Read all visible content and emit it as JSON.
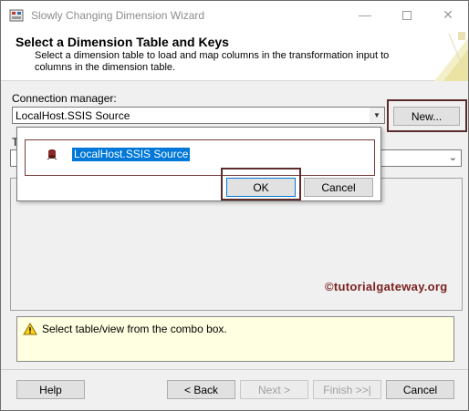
{
  "window": {
    "title": "Slowly Changing Dimension Wizard",
    "minimize_glyph": "—",
    "close_glyph": "✕"
  },
  "header": {
    "title": "Select a Dimension Table and Keys",
    "description": "Select a dimension table to load and map columns in the transformation input to columns in the dimension table."
  },
  "connection": {
    "label": "Connection manager:",
    "value": "LocalHost.SSIS Source",
    "new_button": "New..."
  },
  "table": {
    "label_fragment": "T",
    "chevron": "⌄"
  },
  "popup": {
    "items": [
      {
        "label": "LocalHost.SSIS Source",
        "icon": "data-source-icon",
        "selected": true
      }
    ],
    "ok_button": "OK",
    "cancel_button": "Cancel"
  },
  "watermark": "©tutorialgateway.org",
  "warning": {
    "icon": "warning-icon",
    "text": "Select table/view from the combo box."
  },
  "footer": {
    "help": "Help",
    "back": "< Back",
    "next": "Next >",
    "finish": "Finish >>|",
    "cancel": "Cancel"
  },
  "colors": {
    "highlight_border": "#5b2c2c",
    "selection_blue": "#0078d7",
    "warning_bg": "#ffffe1",
    "watermark": "#7a1f1f"
  }
}
